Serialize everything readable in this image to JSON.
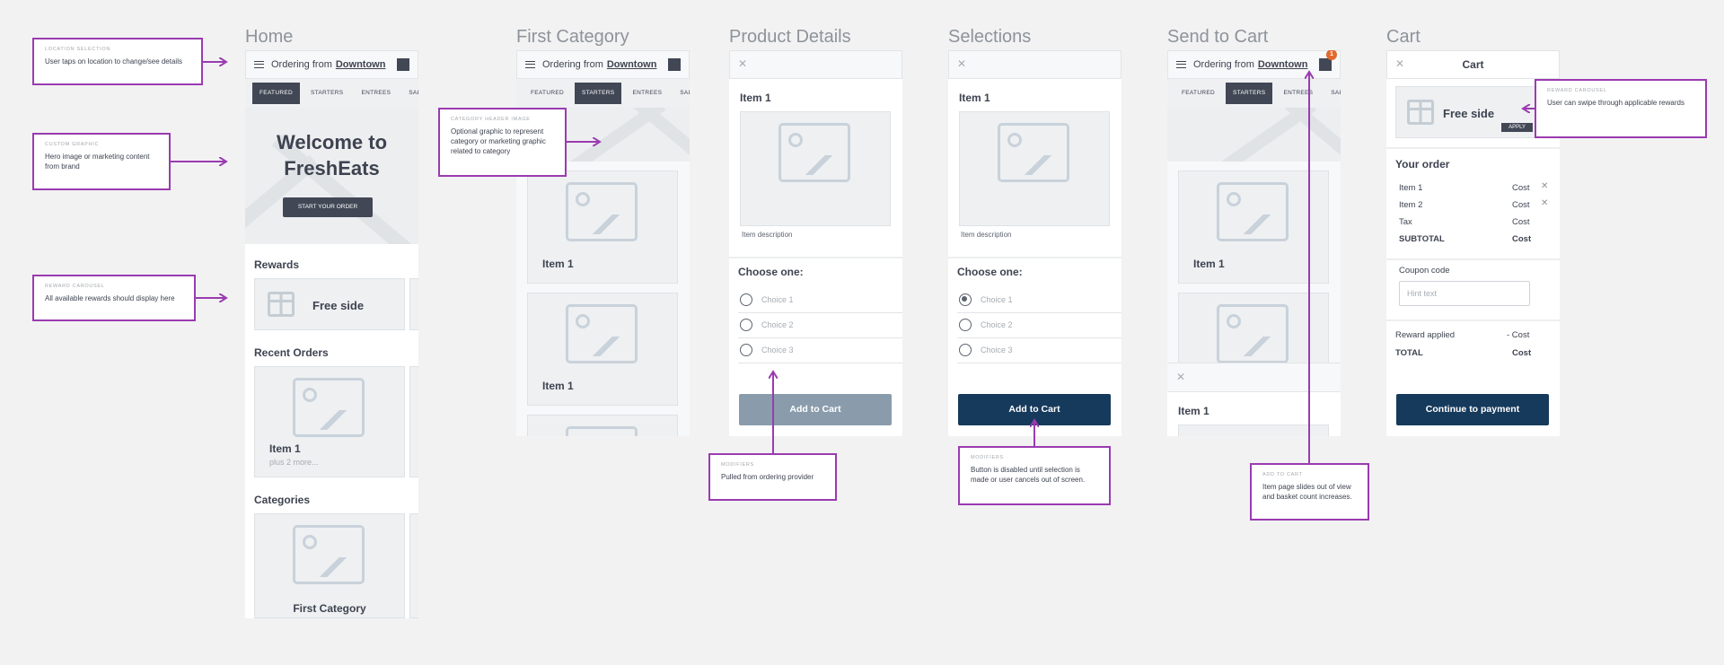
{
  "titles": {
    "home": "Home",
    "first_category": "First Category",
    "product_details": "Product Details",
    "selections": "Selections",
    "send_to_cart": "Send to Cart",
    "cart": "Cart"
  },
  "header": {
    "ordering_from": "Ordering from",
    "location": "Downtown",
    "badge_count": "1"
  },
  "tabs": [
    "FEATURED",
    "STARTERS",
    "ENTREES",
    "SALADS",
    "S"
  ],
  "home": {
    "hero_title_1": "Welcome to",
    "hero_title_2": "FreshEats",
    "start_button": "START YOUR ORDER",
    "rewards_heading": "Rewards",
    "reward_name": "Free side",
    "recent_orders_heading": "Recent Orders",
    "recent_item": "Item 1",
    "recent_more": "plus 2 more...",
    "categories_heading": "Categories",
    "category_name": "First Category"
  },
  "first_category": {
    "item_a": "Item 1",
    "item_b": "Item 1"
  },
  "product": {
    "item_title": "Item 1",
    "item_description": "Item description",
    "choose_heading": "Choose one:",
    "choices": [
      "Choice 1",
      "Choice 2",
      "Choice 3"
    ],
    "add_to_cart": "Add to Cart"
  },
  "send_to_cart": {
    "item_a": "Item 1",
    "item_b": "Item 1"
  },
  "cart": {
    "title": "Cart",
    "reward_name": "Free side",
    "apply": "APPLY",
    "your_order": "Your order",
    "lines": [
      {
        "name": "Item 1",
        "value": "Cost"
      },
      {
        "name": "Item 2",
        "value": "Cost"
      },
      {
        "name": "Tax",
        "value": "Cost"
      },
      {
        "name": "SUBTOTAL",
        "value": "Cost"
      }
    ],
    "coupon_label": "Coupon code",
    "coupon_placeholder": "Hint text",
    "reward_applied_label": "Reward applied",
    "reward_applied_value": "- Cost",
    "total_label": "TOTAL",
    "total_value": "Cost",
    "continue": "Continue to payment"
  },
  "notes": {
    "location": {
      "title": "LOCATION SELECTION",
      "body": "User taps on location to change/see details"
    },
    "custom": {
      "title": "CUSTOM GRAPHIC",
      "body": "Hero image or marketing content from brand"
    },
    "reward_home": {
      "title": "REWARD CAROUSEL",
      "body": "All available rewards should display here"
    },
    "category": {
      "title": "CATEGORY HEADER IMAGE",
      "body": "Optional graphic to represent category or marketing graphic related to category"
    },
    "modifiers_1": {
      "title": "MODIFIERS",
      "body": "Pulled from ordering provider"
    },
    "modifiers_2": {
      "title": "MODIFIERS",
      "body": "Button is disabled until selection is made or user cancels out of screen."
    },
    "add_to_cart": {
      "title": "ADD TO CART",
      "body": "Item page slides out of view and basket count increases."
    },
    "reward_cart": {
      "title": "REWARD CAROUSEL",
      "body": "User can swipe through applicable rewards"
    }
  },
  "colors": {
    "accent": "#9a3bb0",
    "primary_button": "#163a5c",
    "disabled_button": "#8a9cac",
    "badge": "#e4682d"
  }
}
